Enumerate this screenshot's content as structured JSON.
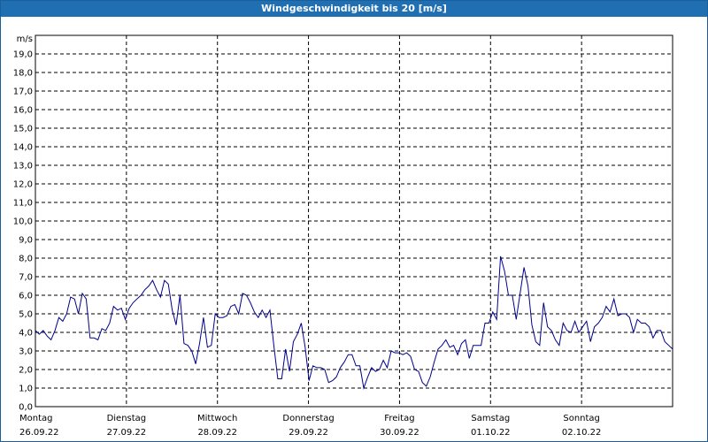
{
  "title": "Windgeschwindigkeit bis 20 [m/s]",
  "colors": {
    "title_bg": "#1f6fb2",
    "title_fg": "#ffffff",
    "line": "#00008b",
    "grid": "#000000"
  },
  "chart_data": {
    "type": "line",
    "title": "Windgeschwindigkeit bis 20 [m/s]",
    "ylabel": "m/s",
    "ylim": [
      0,
      20
    ],
    "xlim": [
      0,
      7
    ],
    "grid": true,
    "y_ticks": [
      "0,0",
      "1,0",
      "2,0",
      "3,0",
      "4,0",
      "5,0",
      "6,0",
      "7,0",
      "8,0",
      "9,0",
      "10,0",
      "11,0",
      "12,0",
      "13,0",
      "14,0",
      "15,0",
      "16,0",
      "17,0",
      "18,0",
      "19,0"
    ],
    "x_ticks": [
      {
        "day": "Montag",
        "date": "26.09.22"
      },
      {
        "day": "Dienstag",
        "date": "27.09.22"
      },
      {
        "day": "Mittwoch",
        "date": "28.09.22"
      },
      {
        "day": "Donnerstag",
        "date": "29.09.22"
      },
      {
        "day": "Freitag",
        "date": "30.09.22"
      },
      {
        "day": "Samstag",
        "date": "01.10.22"
      },
      {
        "day": "Sonntag",
        "date": "02.10.22"
      }
    ],
    "series": [
      {
        "values": [
          4.1,
          3.9,
          4.1,
          3.8,
          3.6,
          4.1,
          4.8,
          4.6,
          5.0,
          5.9,
          5.8,
          5.0,
          6.1,
          5.8,
          3.7,
          3.7,
          3.6,
          4.2,
          4.1,
          4.5,
          5.4,
          5.2,
          5.3,
          4.7,
          5.3,
          5.6,
          5.8,
          6.0,
          6.3,
          6.5,
          6.8,
          6.3,
          5.9,
          6.8,
          6.6,
          5.2,
          4.4,
          6.0,
          3.4,
          3.3,
          3.0,
          2.3,
          3.4,
          4.8,
          3.2,
          3.3,
          5.0,
          4.8,
          4.8,
          4.9,
          5.4,
          5.5,
          5.0,
          6.1,
          6.0,
          5.6,
          5.1,
          4.8,
          5.2,
          4.8,
          5.2,
          3.3,
          1.5,
          1.5,
          3.1,
          1.9,
          3.5,
          3.9,
          4.5,
          3.2,
          1.4,
          2.2,
          2.1,
          2.1,
          2.0,
          1.3,
          1.4,
          1.6,
          2.1,
          2.4,
          2.8,
          2.8,
          2.2,
          2.2,
          1.0,
          1.6,
          2.1,
          1.9,
          2.0,
          2.5,
          2.1,
          3.0,
          2.9,
          2.9,
          2.8,
          2.9,
          2.7,
          2.0,
          1.9,
          1.3,
          1.1,
          1.6,
          2.4,
          3.1,
          3.3,
          3.6,
          3.2,
          3.3,
          2.8,
          3.4,
          3.6,
          2.6,
          3.3,
          3.3,
          3.3,
          4.5,
          4.5,
          5.1,
          4.7,
          8.1,
          7.3,
          6.0,
          6.0,
          4.7,
          6.1,
          7.5,
          6.5,
          4.4,
          3.5,
          3.3,
          5.6,
          4.3,
          4.1,
          3.6,
          3.3,
          4.5,
          4.1,
          4.0,
          4.6,
          4.0,
          4.3,
          4.6,
          3.5,
          4.3,
          4.5,
          4.8,
          5.4,
          5.1,
          5.8,
          4.9,
          5.0,
          5.0,
          4.8,
          4.0,
          4.7,
          4.5,
          4.5,
          4.3,
          3.7,
          4.1,
          4.1,
          3.5,
          3.3,
          3.1
        ]
      }
    ]
  }
}
